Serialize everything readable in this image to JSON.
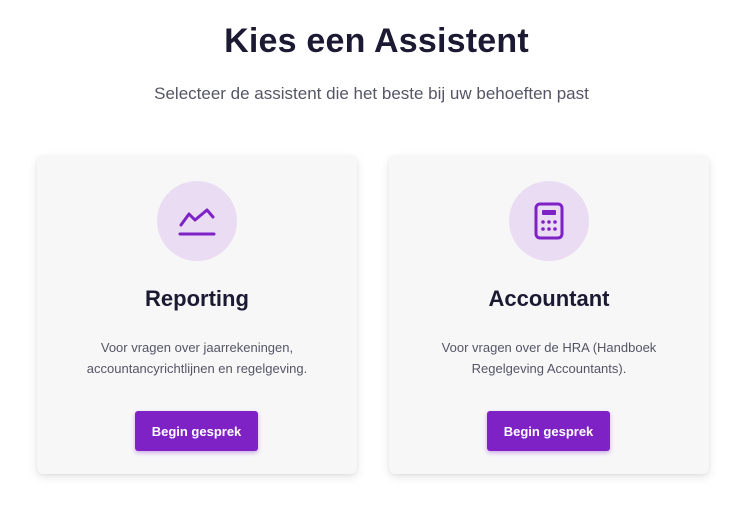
{
  "header": {
    "title": "Kies een Assistent",
    "subtitle": "Selecteer de assistent die het beste bij uw behoeften past"
  },
  "cards": [
    {
      "icon": "line-chart-icon",
      "title": "Reporting",
      "description": "Voor vragen over jaarrekeningen, accountancyrichtlijnen en regelgeving.",
      "button_label": "Begin gesprek"
    },
    {
      "icon": "calculator-icon",
      "title": "Accountant",
      "description": "Voor vragen over de HRA (Handboek Regelgeving Accountants).",
      "button_label": "Begin gesprek"
    }
  ],
  "colors": {
    "accent": "#7e22c6",
    "icon_background": "#eadcf3",
    "heading": "#1c1a33",
    "card_background": "#f7f7f8"
  }
}
